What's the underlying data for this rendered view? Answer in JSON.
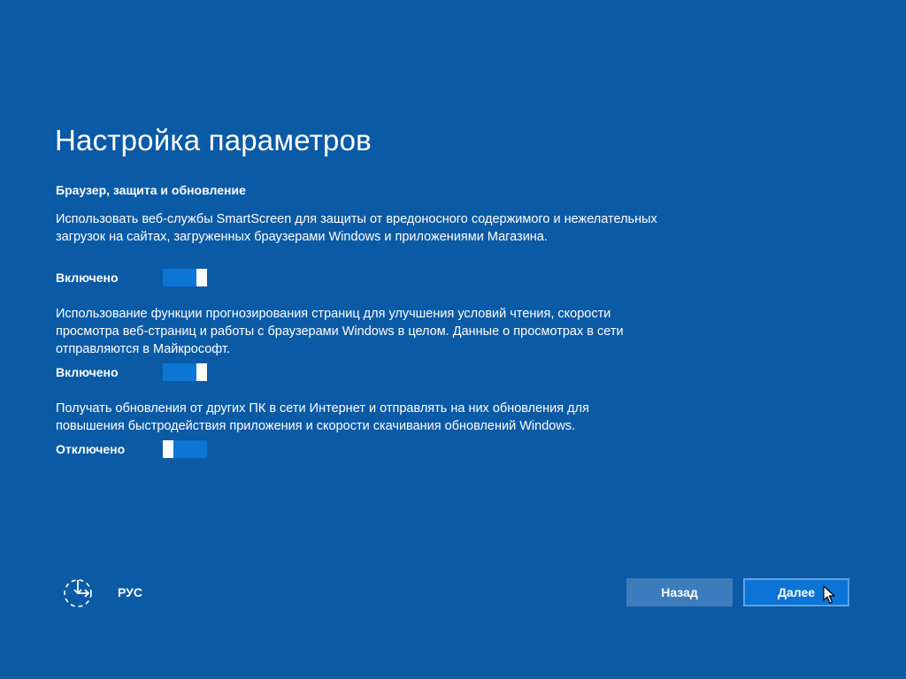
{
  "page": {
    "title": "Настройка параметров",
    "section_heading": "Браузер, защита и обновление"
  },
  "settings": [
    {
      "description": "Использовать веб-службы SmartScreen для защиты от вредоносного содержимого и нежелательных загрузок на сайтах, загруженных браузерами Windows и приложениями Магазина.",
      "state_label": "Включено",
      "state": "on"
    },
    {
      "description": "Использование функции прогнозирования страниц для улучшения условий чтения, скорости просмотра веб-страниц и работы с браузерами Windows в целом. Данные о просмотрах в сети отправляются в Майкрософт.",
      "state_label": "Включено",
      "state": "on"
    },
    {
      "description": "Получать обновления от других ПК в сети Интернет и отправлять на них обновления для повышения быстродействия приложения и скорости скачивания обновлений Windows.",
      "state_label": "Отключено",
      "state": "off"
    }
  ],
  "footer": {
    "language_icon": "accessibility-icon",
    "language_label": "РУС",
    "back_label": "Назад",
    "next_label": "Далее"
  },
  "colors": {
    "background": "#0a5aa6",
    "toggle_fill": "#0b76d4",
    "back_button": "#3d7cbc",
    "next_button": "#0b74d6",
    "next_border": "#5aa2e6"
  }
}
